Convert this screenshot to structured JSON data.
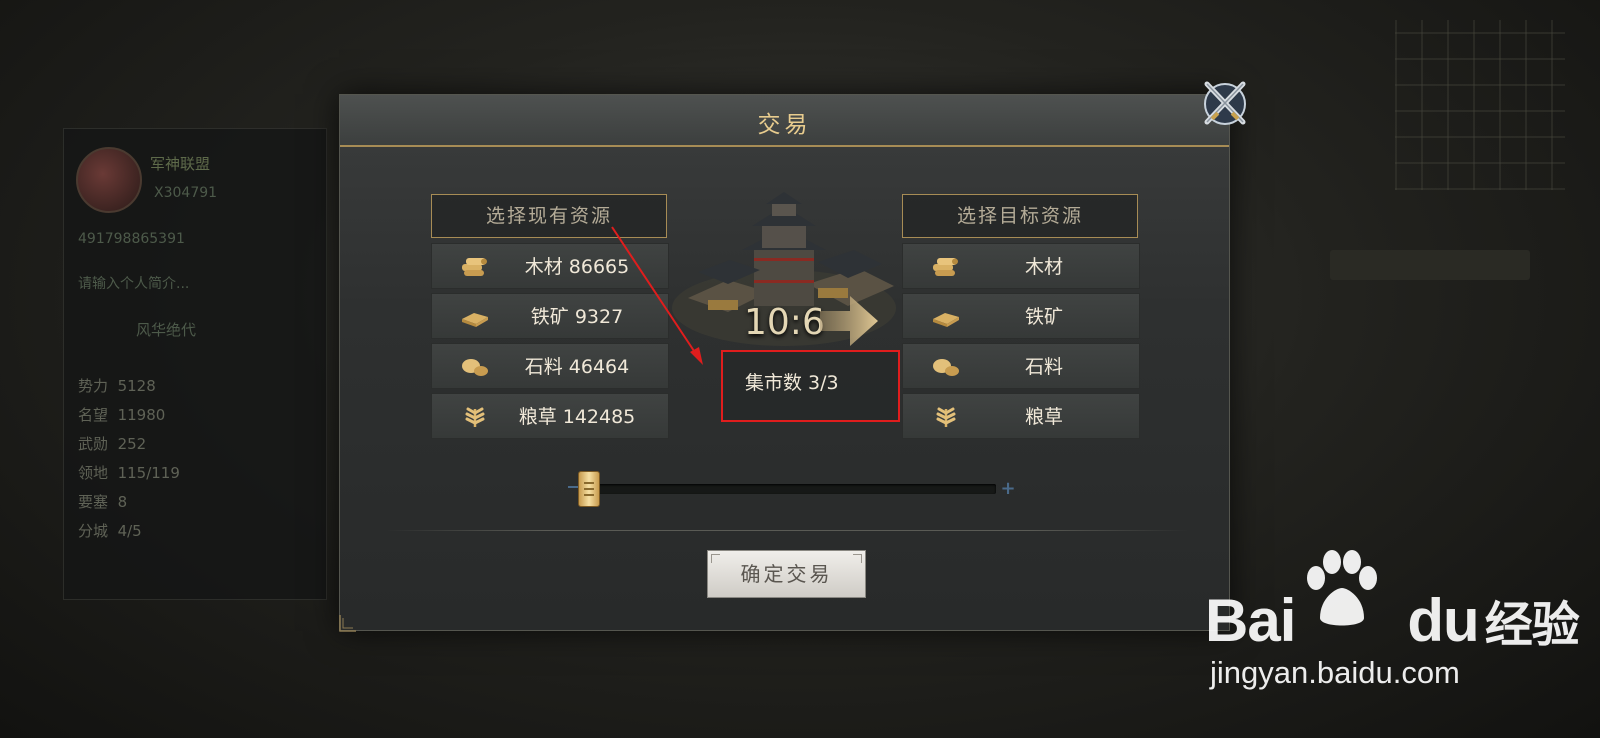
{
  "background": {
    "guild_name": "军神联盟",
    "player_id": "X304791",
    "account_id": "491798865391",
    "signature_placeholder": "请输入个人简介...",
    "title": "风华绝代",
    "stats": [
      {
        "label": "势力",
        "value": "5128"
      },
      {
        "label": "名望",
        "value": "11980"
      },
      {
        "label": "武勋",
        "value": "252"
      },
      {
        "label": "领地",
        "value": "115/119"
      },
      {
        "label": "要塞",
        "value": "8"
      },
      {
        "label": "分城",
        "value": "4/5"
      }
    ]
  },
  "dialog": {
    "title": "交易",
    "left_header": "选择现有资源",
    "right_header": "选择目标资源",
    "left_resources": [
      {
        "icon": "wood-icon",
        "label": "木材 86665"
      },
      {
        "icon": "iron-icon",
        "label": "铁矿 9327"
      },
      {
        "icon": "stone-icon",
        "label": "石料 46464"
      },
      {
        "icon": "grain-icon",
        "label": "粮草 142485"
      }
    ],
    "right_resources": [
      {
        "icon": "wood-icon",
        "label": "木材"
      },
      {
        "icon": "iron-icon",
        "label": "铁矿"
      },
      {
        "icon": "stone-icon",
        "label": "石料"
      },
      {
        "icon": "grain-icon",
        "label": "粮草"
      }
    ],
    "ratio": "10:6",
    "market_count": "集市数 3/3",
    "slider_value": 0,
    "confirm_label": "确定交易"
  },
  "watermark": {
    "brand": "Bai",
    "brand_suffix": "du",
    "brand_cn": "经验",
    "url": "jingyan.baidu.com"
  },
  "colors": {
    "gold_accent": "#a78c55",
    "title_gold": "#e8cc8e",
    "annotation_red": "#e01d1d"
  }
}
